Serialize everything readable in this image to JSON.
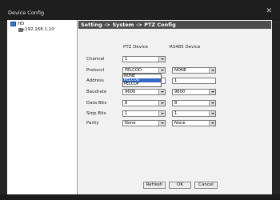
{
  "window": {
    "title": "Device Config"
  },
  "tree": {
    "root_label": "HD",
    "device_label": "192.168.1.10"
  },
  "panel": {
    "header": "Setting -> System -> PTZ Config",
    "col_ptz": "PTZ Device",
    "col_rs485": "RS485 Device",
    "fields": {
      "channel": {
        "label": "Channel",
        "ptz": "1"
      },
      "protocol": {
        "label": "Protocol",
        "ptz": "PELCOD",
        "rs485": "NONE"
      },
      "address": {
        "label": "Address",
        "ptz": "1",
        "rs485": "1"
      },
      "baudrate": {
        "label": "Baudrate",
        "ptz": "9600",
        "rs485": "9600"
      },
      "data_bits": {
        "label": "Data Bits",
        "ptz": "8",
        "rs485": "8"
      },
      "stop_bits": {
        "label": "Stop Bits",
        "ptz": "1",
        "rs485": "1"
      },
      "parity": {
        "label": "Parity",
        "ptz": "None",
        "rs485": "None"
      }
    },
    "protocol_dropdown": {
      "options": [
        "NONE",
        "PELCOD",
        "PELCOP"
      ],
      "highlighted": "PELCOD"
    }
  },
  "buttons": {
    "refresh": "Refresh",
    "ok": "OK",
    "cancel": "Cancel"
  }
}
